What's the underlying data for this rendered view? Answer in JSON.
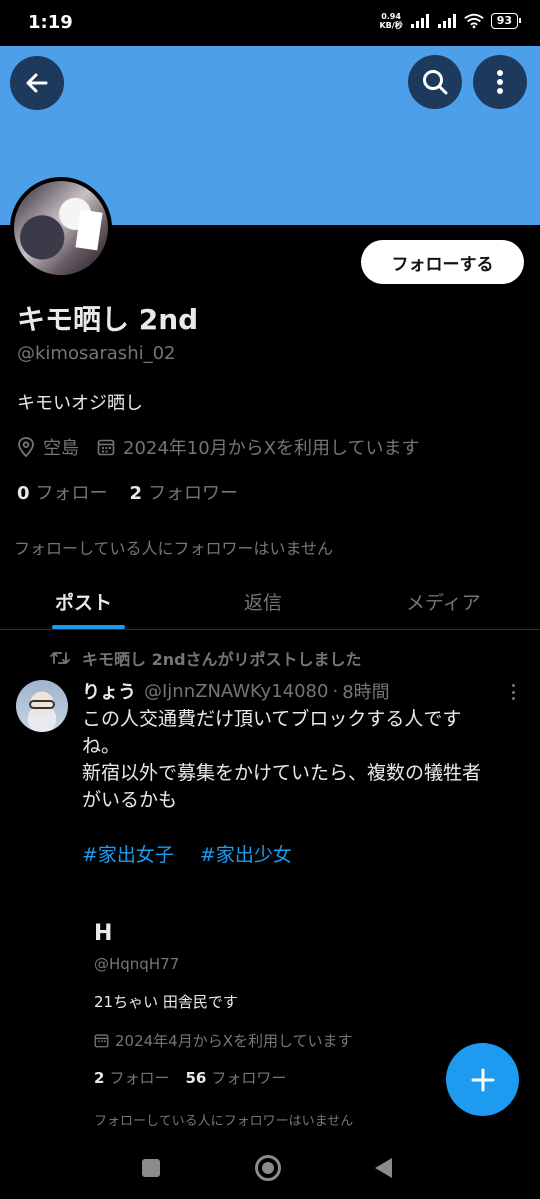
{
  "status_bar": {
    "time": "1:19",
    "net_speed_value": "0.94",
    "net_speed_unit": "KB/秒",
    "battery": "93"
  },
  "header": {
    "back_icon": "arrow-left-icon",
    "search_icon": "search-icon",
    "more_icon": "more-vertical-icon",
    "banner_color": "#4d9fea"
  },
  "profile": {
    "follow_button": "フォローする",
    "display_name": "キモ晒し 2nd",
    "handle": "@kimosarashi_02",
    "bio": "キモいオジ晒し",
    "location": "空島",
    "joined": "2024年10月からXを利用しています",
    "following_count": "0",
    "following_label": "フォロー",
    "followers_count": "2",
    "followers_label": "フォロワー",
    "no_mutual_followers": "フォローしている人にフォロワーはいません"
  },
  "tabs": [
    {
      "label": "ポスト",
      "active": true
    },
    {
      "label": "返信",
      "active": false
    },
    {
      "label": "メディア",
      "active": false
    }
  ],
  "post": {
    "repost_text": "キモ晒し 2ndさんがリポストしました",
    "author_name": "りょう",
    "author_handle": "@IjnnZNAWKy14080",
    "separator": "·",
    "time": "8時間",
    "body_lines": [
      "この人交通費だけ頂いてブロックする人です",
      "ね。",
      "新宿以外で募集をかけていたら、複数の犠牲者",
      "がいるかも"
    ],
    "hashtags": [
      "#家出女子",
      "#家出少女"
    ],
    "embedded_profile": {
      "name": "H",
      "handle": "@HqnqH77",
      "bio": "21ちゃい 田舎民です",
      "joined": "2024年4月からXを利用しています",
      "following_count": "2",
      "following_label": "フォロー",
      "followers_count": "56",
      "followers_label": "フォロワー",
      "no_mutual_followers": "フォローしている人にフォロワーはいません"
    }
  },
  "fab": {
    "icon": "plus-icon",
    "color": "#1d9bf0"
  },
  "colors": {
    "accent": "#1d9bf0",
    "muted": "#71767b",
    "text": "#e7e9ea"
  }
}
